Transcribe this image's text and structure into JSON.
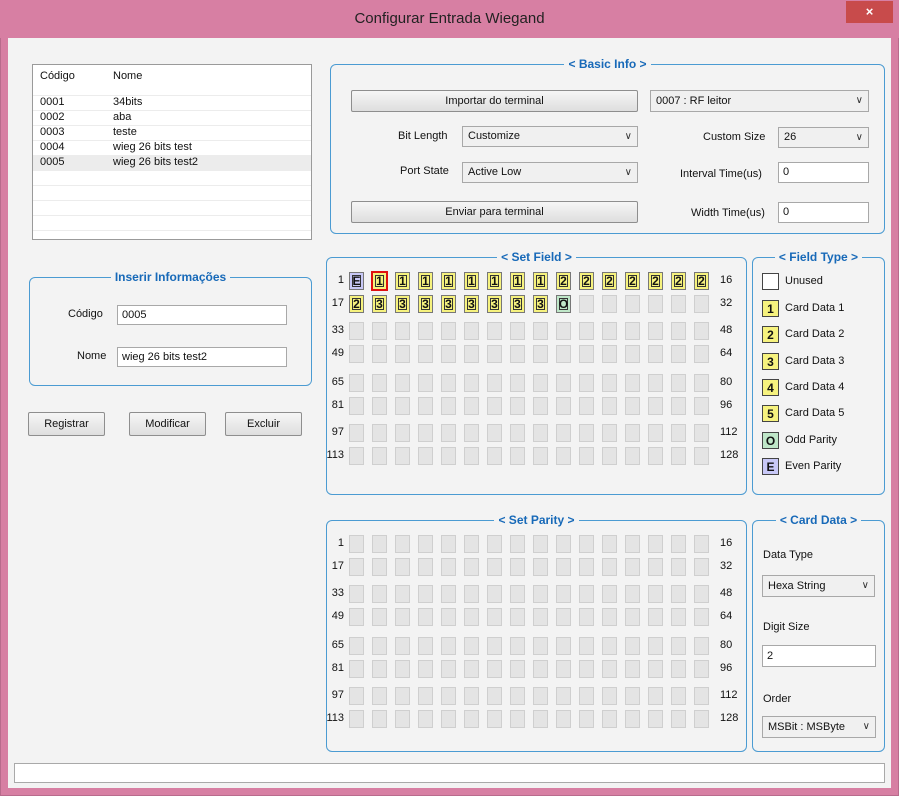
{
  "window": {
    "title": "Configurar Entrada Wiegand",
    "close_glyph": "×"
  },
  "list": {
    "headers": [
      "Código",
      "Nome"
    ],
    "rows": [
      {
        "code": "0001",
        "name": "34bits"
      },
      {
        "code": "0002",
        "name": "aba"
      },
      {
        "code": "0003",
        "name": "teste"
      },
      {
        "code": "0004",
        "name": "wieg 26 bits test"
      },
      {
        "code": "0005",
        "name": "wieg 26 bits test2",
        "selected": true
      }
    ]
  },
  "insert_info": {
    "title": "Inserir Informações",
    "code_label": "Código",
    "code_value": "0005",
    "name_label": "Nome",
    "name_value": "wieg 26 bits test2"
  },
  "actions": {
    "register": "Registrar",
    "modify": "Modificar",
    "delete": "Excluir"
  },
  "basic_info": {
    "title": "< Basic Info >",
    "import_button": "Importar do terminal",
    "terminal_select": "0007 : RF leitor",
    "bit_length_label": "Bit Length",
    "bit_length_value": "Customize",
    "custom_size_label": "Custom Size",
    "custom_size_value": "26",
    "port_state_label": "Port State",
    "port_state_value": "Active Low",
    "interval_label": "Interval Time(us)",
    "interval_value": "0",
    "send_button": "Enviar para terminal",
    "width_label": "Width Time(us)",
    "width_value": "0"
  },
  "set_field": {
    "title": "< Set Field >",
    "row_starts": [
      "1",
      "17",
      "33",
      "49",
      "65",
      "81",
      "97",
      "113"
    ],
    "row_ends": [
      "16",
      "32",
      "48",
      "64",
      "80",
      "96",
      "112",
      "128"
    ],
    "bits": [
      "E",
      "1",
      "1",
      "1",
      "1",
      "1",
      "1",
      "1",
      "1",
      "2",
      "2",
      "2",
      "2",
      "2",
      "2",
      "2",
      "2",
      "3",
      "3",
      "3",
      "3",
      "3",
      "3",
      "3",
      "3",
      "O"
    ],
    "selected_bit": 2
  },
  "field_type": {
    "title": "< Field Type >",
    "items": [
      {
        "symbol": "",
        "label": "Unused",
        "color": "#ffffff"
      },
      {
        "symbol": "1",
        "label": "Card Data 1",
        "color": "#f6f27e"
      },
      {
        "symbol": "2",
        "label": "Card Data 2",
        "color": "#f6f27e"
      },
      {
        "symbol": "3",
        "label": "Card Data 3",
        "color": "#f6f27e"
      },
      {
        "symbol": "4",
        "label": "Card Data 4",
        "color": "#f6f27e"
      },
      {
        "symbol": "5",
        "label": "Card Data 5",
        "color": "#f6f27e"
      },
      {
        "symbol": "O",
        "label": "Odd Parity",
        "color": "#bfe7c8"
      },
      {
        "symbol": "E",
        "label": "Even Parity",
        "color": "#c8c8f7"
      }
    ]
  },
  "set_parity": {
    "title": "< Set Parity >",
    "row_starts": [
      "1",
      "17",
      "33",
      "49",
      "65",
      "81",
      "97",
      "113"
    ],
    "row_ends": [
      "16",
      "32",
      "48",
      "64",
      "80",
      "96",
      "112",
      "128"
    ]
  },
  "card_data": {
    "title": "< Card Data >",
    "data_type_label": "Data Type",
    "data_type_value": "Hexa String",
    "digit_size_label": "Digit Size",
    "digit_size_value": "2",
    "order_label": "Order",
    "order_value": "MSBit : MSByte"
  },
  "status_bar": {
    "text": ""
  }
}
